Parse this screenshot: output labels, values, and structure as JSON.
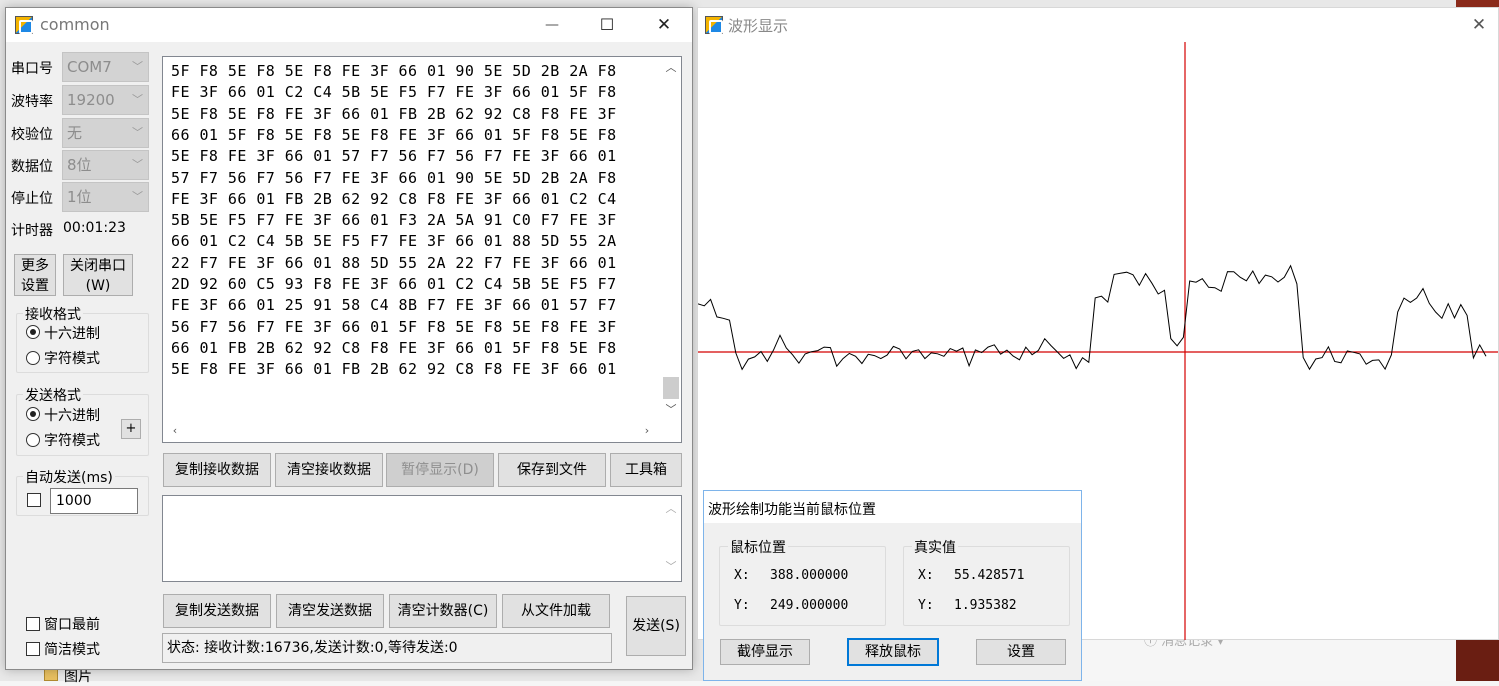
{
  "common_window": {
    "title": "common",
    "minimize": "—",
    "maximize": "☐",
    "close": "✕",
    "serial_settings": [
      {
        "label": "串口号",
        "value": "COM7"
      },
      {
        "label": "波特率",
        "value": "19200"
      },
      {
        "label": "校验位",
        "value": "无"
      },
      {
        "label": "数据位",
        "value": "8位"
      },
      {
        "label": "停止位",
        "value": "1位"
      }
    ],
    "timer_label": "计时器",
    "timer_value": "00:01:23",
    "more_settings_line1": "更多",
    "more_settings_line2": "设置",
    "close_port_line1": "关闭串口",
    "close_port_line2": "(W)",
    "receive_format": {
      "title": "接收格式",
      "options": [
        "十六进制",
        "字符模式"
      ],
      "selected": "十六进制"
    },
    "send_format": {
      "title": "发送格式",
      "options": [
        "十六进制",
        "字符模式"
      ],
      "selected": "十六进制",
      "plus": "+"
    },
    "auto_send": {
      "title": "自动发送(ms)",
      "checked": false,
      "interval": "1000"
    },
    "window_top_label": "窗口最前",
    "simple_mode_label": "简洁模式",
    "hex_lines": [
      "5F F8 5E F8 5E F8 FE 3F 66 01 90 5E 5D 2B 2A F8",
      "FE 3F 66 01 C2 C4 5B 5E F5 F7 FE 3F 66 01 5F F8",
      "5E F8 5E F8 FE 3F 66 01 FB 2B 62 92 C8 F8 FE 3F",
      "66 01 5F F8 5E F8 5E F8 FE 3F 66 01 5F F8 5E F8",
      "5E F8 FE 3F 66 01 57 F7 56 F7 56 F7 FE 3F 66 01",
      "57 F7 56 F7 56 F7 FE 3F 66 01 90 5E 5D 2B 2A F8",
      "FE 3F 66 01 FB 2B 62 92 C8 F8 FE 3F 66 01 C2 C4",
      "5B 5E F5 F7 FE 3F 66 01 F3 2A 5A 91 C0 F7 FE 3F",
      "66 01 C2 C4 5B 5E F5 F7 FE 3F 66 01 88 5D 55 2A",
      "22 F7 FE 3F 66 01 88 5D 55 2A 22 F7 FE 3F 66 01",
      "2D 92 60 C5 93 F8 FE 3F 66 01 C2 C4 5B 5E F5 F7",
      "FE 3F 66 01 25 91 58 C4 8B F7 FE 3F 66 01 57 F7",
      "56 F7 56 F7 FE 3F 66 01 5F F8 5E F8 5E F8 FE 3F",
      "66 01 FB 2B 62 92 C8 F8 FE 3F 66 01 5F F8 5E F8",
      "5E F8 FE 3F 66 01 FB 2B 62 92 C8 F8 FE 3F 66 01"
    ],
    "receive_buttons": [
      "复制接收数据",
      "清空接收数据",
      "暂停显示(D)",
      "保存到文件",
      "工具箱"
    ],
    "send_buttons": [
      "复制发送数据",
      "清空发送数据",
      "清空计数器(C)",
      "从文件加载"
    ],
    "send_button": "发送(S)",
    "status": "状态: 接收计数:16736,发送计数:0,等待发送:0"
  },
  "wave_window": {
    "title": "波形显示",
    "close": "✕",
    "colors": {
      "trace": "#000000",
      "cursor": "#d40000"
    },
    "trace_y": [
      296,
      312,
      350,
      350,
      340,
      350,
      343,
      345,
      350,
      350,
      345,
      345,
      350,
      345,
      345,
      340,
      345,
      350,
      343,
      345,
      355,
      290,
      267,
      270,
      278,
      325,
      270,
      285,
      267,
      270,
      273,
      270,
      350,
      350,
      350,
      350,
      350,
      300,
      295,
      300,
      310,
      350
    ]
  },
  "popup": {
    "title": "波形绘制功能当前鼠标位置",
    "mouse_group": "鼠标位置",
    "real_group": "真实值",
    "mouse_x_label": "X:",
    "mouse_x": "388.000000",
    "mouse_y_label": "Y:",
    "mouse_y": "249.000000",
    "real_x_label": "X:",
    "real_x": "55.428571",
    "real_y_label": "Y:",
    "real_y": "1.935382",
    "pause_button": "截停显示",
    "release_button": "释放鼠标",
    "settings_button": "设置"
  },
  "background": {
    "pictures_label": "图片",
    "behind_text": "ⓘ 消息记录 ▾"
  }
}
